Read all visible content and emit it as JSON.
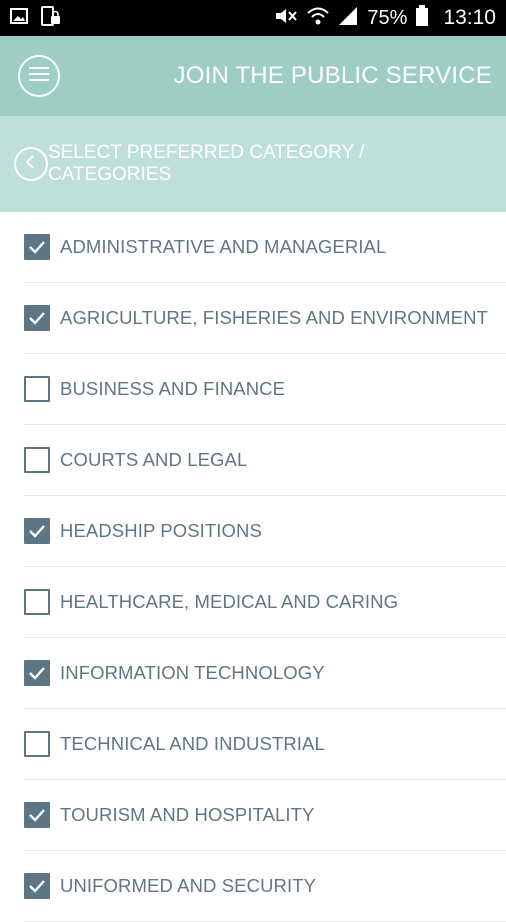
{
  "status_bar": {
    "battery": "75%",
    "time": "13:10",
    "icons": [
      "image-icon",
      "phone-lock-icon",
      "mute-icon",
      "wifi-icon",
      "signal-icon",
      "battery-icon"
    ]
  },
  "header": {
    "title": "JOIN THE PUBLIC SERVICE",
    "menu_icon": "menu-icon"
  },
  "subheader": {
    "title": "SELECT PREFERRED CATEGORY / CATEGORIES",
    "back_icon": "chevron-left-icon"
  },
  "colors": {
    "app_bar": "#9ecdc4",
    "sub_bar": "#bfe0d9",
    "checkbox": "#5c7686",
    "text": "#5f7785"
  },
  "categories": [
    {
      "label": "ADMINISTRATIVE AND MANAGERIAL",
      "checked": true
    },
    {
      "label": "AGRICULTURE, FISHERIES AND ENVIRONMENT",
      "checked": true
    },
    {
      "label": "BUSINESS AND FINANCE",
      "checked": false
    },
    {
      "label": "COURTS AND LEGAL",
      "checked": false
    },
    {
      "label": "HEADSHIP POSITIONS",
      "checked": true
    },
    {
      "label": "HEALTHCARE, MEDICAL AND CARING",
      "checked": false
    },
    {
      "label": "INFORMATION TECHNOLOGY",
      "checked": true
    },
    {
      "label": "TECHNICAL AND INDUSTRIAL",
      "checked": false
    },
    {
      "label": "TOURISM AND HOSPITALITY",
      "checked": true
    },
    {
      "label": "UNIFORMED AND SECURITY",
      "checked": true
    }
  ]
}
